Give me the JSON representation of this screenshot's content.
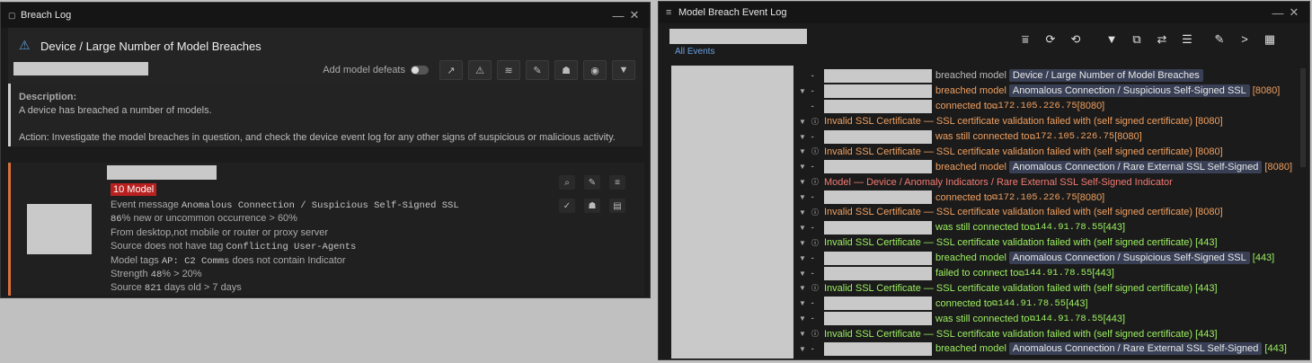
{
  "left_window": {
    "title": "Breach Log",
    "model_title": "Device / Large Number of Model Breaches",
    "add_model_defeats": "Add model defeats",
    "description_label": "Description:",
    "description_text": "A device has breached a number of models.",
    "action_text": "Action: Investigate the model breaches in question, and check the device event log for any other signs of suspicious or malicious activity.",
    "badge": "10 Model",
    "details": [
      {
        "prefix": "Event message ",
        "mono": "Anomalous Connection / Suspicious Self-Signed SSL",
        "suffix": ""
      },
      {
        "prefix": "",
        "mono": "86",
        "suffix": "% new or uncommon occurrence > 60%"
      },
      {
        "prefix": "From desktop,not mobile or router or proxy server",
        "mono": "",
        "suffix": ""
      },
      {
        "prefix": "Source does not have tag ",
        "mono": "Conflicting User-Agents",
        "suffix": ""
      },
      {
        "prefix": "Model tags ",
        "mono": "AP: C2 Comms",
        "suffix": " does not contain Indicator"
      },
      {
        "prefix": "Strength ",
        "mono": "48",
        "suffix": "% > 20%"
      },
      {
        "prefix": "Source ",
        "mono": "821",
        "suffix": " days old > 7 days"
      }
    ]
  },
  "right_window": {
    "title": "Model Breach Event Log",
    "filter_link": "All Events",
    "events": [
      {
        "arrow": false,
        "icon": "",
        "ph": true,
        "verb": "breached model",
        "vclass": "wh",
        "pill": "Device / Large Number of Model Breaches",
        "target": "",
        "port": "",
        "tclass": ""
      },
      {
        "arrow": true,
        "icon": "",
        "ph": true,
        "verb": "breached model",
        "vclass": "or",
        "pill": "Anomalous Connection / Suspicious Self-Signed SSL",
        "target": "",
        "port": "[8080]",
        "tclass": "or"
      },
      {
        "arrow": false,
        "icon": "",
        "ph": true,
        "verb": "connected to",
        "vclass": "or",
        "pill": "",
        "target": "172.105.226.75",
        "port": "[8080]",
        "tclass": "or"
      },
      {
        "arrow": true,
        "icon": "i",
        "ph": false,
        "verb": "Invalid SSL Certificate — SSL certificate validation failed with (self signed certificate) [8080]",
        "vclass": "or",
        "pill": "",
        "target": "",
        "port": "",
        "tclass": ""
      },
      {
        "arrow": true,
        "icon": "",
        "ph": true,
        "verb": "was still connected to",
        "vclass": "or",
        "pill": "",
        "target": "172.105.226.75",
        "port": "[8080]",
        "tclass": "or"
      },
      {
        "arrow": true,
        "icon": "i",
        "ph": false,
        "verb": "Invalid SSL Certificate — SSL certificate validation failed with (self signed certificate) [8080]",
        "vclass": "or",
        "pill": "",
        "target": "",
        "port": "",
        "tclass": ""
      },
      {
        "arrow": true,
        "icon": "",
        "ph": true,
        "verb": "breached model",
        "vclass": "or",
        "pill": "Anomalous Connection / Rare External SSL Self-Signed",
        "target": "",
        "port": "[8080]",
        "tclass": "or"
      },
      {
        "arrow": true,
        "icon": "i",
        "ph": false,
        "verb": "Model — Device / Anomaly Indicators / Rare External SSL Self-Signed Indicator",
        "vclass": "rd",
        "pill": "",
        "target": "",
        "port": "",
        "tclass": ""
      },
      {
        "arrow": true,
        "icon": "",
        "ph": true,
        "verb": "connected to",
        "vclass": "or",
        "pill": "",
        "target": "172.105.226.75",
        "port": "[8080]",
        "tclass": "or"
      },
      {
        "arrow": true,
        "icon": "i",
        "ph": false,
        "verb": "Invalid SSL Certificate — SSL certificate validation failed with (self signed certificate) [8080]",
        "vclass": "or",
        "pill": "",
        "target": "",
        "port": "",
        "tclass": ""
      },
      {
        "arrow": true,
        "icon": "",
        "ph": true,
        "verb": "was still connected to",
        "vclass": "gr",
        "pill": "",
        "target": "144.91.78.55",
        "port": "[443]",
        "tclass": "gr"
      },
      {
        "arrow": true,
        "icon": "i",
        "ph": false,
        "verb": "Invalid SSL Certificate — SSL certificate validation failed with (self signed certificate) [443]",
        "vclass": "gr",
        "pill": "",
        "target": "",
        "port": "",
        "tclass": ""
      },
      {
        "arrow": true,
        "icon": "",
        "ph": true,
        "verb": "breached model",
        "vclass": "gr",
        "pill": "Anomalous Connection / Suspicious Self-Signed SSL",
        "target": "",
        "port": "[443]",
        "tclass": "gr"
      },
      {
        "arrow": true,
        "icon": "",
        "ph": true,
        "verb": "failed to connect to",
        "vclass": "gr",
        "pill": "",
        "target": "144.91.78.55",
        "port": "[443]",
        "tclass": "gr"
      },
      {
        "arrow": true,
        "icon": "i",
        "ph": false,
        "verb": "Invalid SSL Certificate — SSL certificate validation failed with (self signed certificate) [443]",
        "vclass": "gr",
        "pill": "",
        "target": "",
        "port": "",
        "tclass": ""
      },
      {
        "arrow": true,
        "icon": "",
        "ph": true,
        "verb": "connected to",
        "vclass": "gr",
        "pill": "",
        "target": "144.91.78.55",
        "port": "[443]",
        "tclass": "gr"
      },
      {
        "arrow": true,
        "icon": "",
        "ph": true,
        "verb": "was still connected to",
        "vclass": "gr",
        "pill": "",
        "target": "144.91.78.55",
        "port": "[443]",
        "tclass": "gr"
      },
      {
        "arrow": true,
        "icon": "i",
        "ph": false,
        "verb": "Invalid SSL Certificate — SSL certificate validation failed with (self signed certificate) [443]",
        "vclass": "gr",
        "pill": "",
        "target": "",
        "port": "",
        "tclass": ""
      },
      {
        "arrow": true,
        "icon": "",
        "ph": true,
        "verb": "breached model",
        "vclass": "gr",
        "pill": "Anomalous Connection / Rare External SSL Self-Signed",
        "target": "",
        "port": "[443]",
        "tclass": "gr"
      }
    ]
  }
}
